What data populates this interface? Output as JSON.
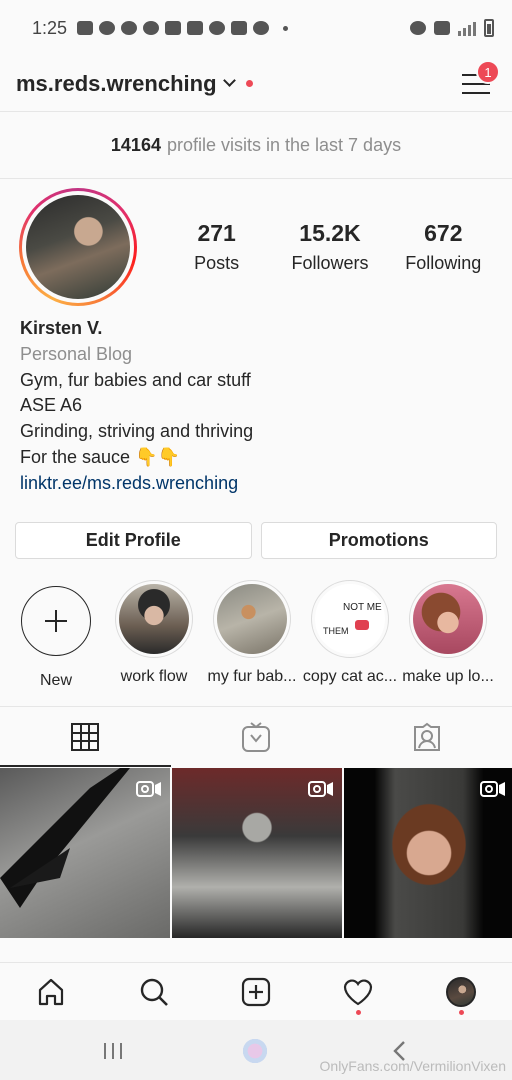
{
  "status": {
    "time": "1:25"
  },
  "header": {
    "username": "ms.reds.wrenching",
    "notification_count": "1"
  },
  "visits": {
    "count": "14164",
    "label": "profile visits in the last 7 days"
  },
  "stats": [
    {
      "value": "271",
      "label": "Posts"
    },
    {
      "value": "15.2K",
      "label": "Followers"
    },
    {
      "value": "672",
      "label": "Following"
    }
  ],
  "bio": {
    "name": "Kirsten V.",
    "category": "Personal Blog",
    "line1": "Gym, fur babies and car stuff",
    "line2": "ASE A6",
    "line3": "Grinding, striving and thriving",
    "line4": "For the sauce",
    "emoji": "👇👇",
    "link": "linktr.ee/ms.reds.wrenching"
  },
  "buttons": {
    "edit": "Edit Profile",
    "promotions": "Promotions"
  },
  "stories": [
    {
      "label": "New"
    },
    {
      "label": "work flow"
    },
    {
      "label": "my fur bab..."
    },
    {
      "label": "copy cat ac..."
    },
    {
      "label": "make up lo..."
    }
  ],
  "story_texts": {
    "not_me": "NOT ME",
    "them": "THEM"
  },
  "watermark": "OnlyFans.com/VermilionVixen",
  "colors": {
    "accent": "#ed4956",
    "link": "#003569",
    "muted": "#8e8e8e"
  }
}
